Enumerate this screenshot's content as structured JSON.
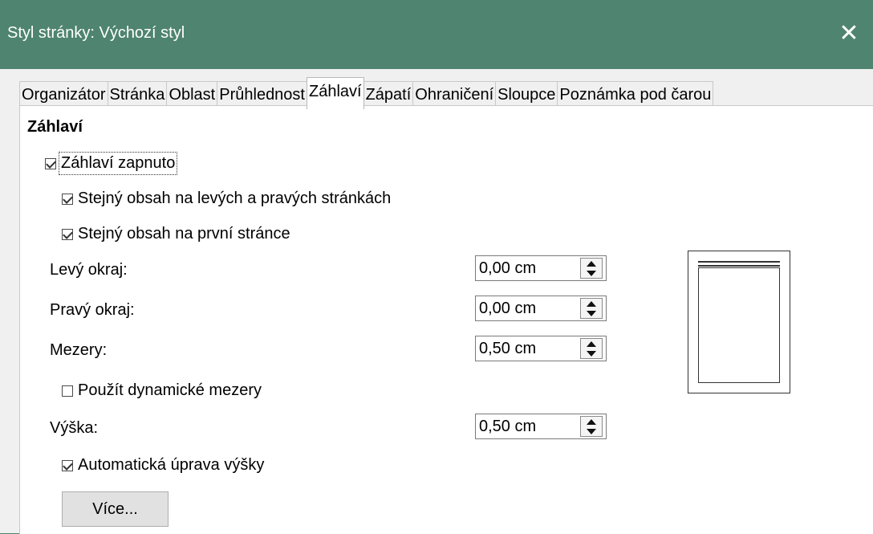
{
  "window": {
    "title": "Styl stránky: Výchozí styl",
    "close_glyph": "✕"
  },
  "tabs": [
    {
      "label": "Organizátor",
      "active": false
    },
    {
      "label": "Stránka",
      "active": false
    },
    {
      "label": "Oblast",
      "active": false
    },
    {
      "label": "Průhlednost",
      "active": false
    },
    {
      "label": "Záhlaví",
      "active": true
    },
    {
      "label": "Zápatí",
      "active": false
    },
    {
      "label": "Ohraničení",
      "active": false
    },
    {
      "label": "Sloupce",
      "active": false
    },
    {
      "label": "Poznámka pod čarou",
      "active": false
    }
  ],
  "header": {
    "section_title": "Záhlaví",
    "header_on": {
      "label": "Záhlaví zapnuto",
      "checked": true
    },
    "same_content_lr": {
      "label": "Stejný obsah na levých a pravých stránkách",
      "checked": true
    },
    "same_content_first": {
      "label": "Stejný obsah na první stránce",
      "checked": true
    },
    "left_margin": {
      "label": "Levý okraj:",
      "value": "0,00 cm"
    },
    "right_margin": {
      "label": "Pravý okraj:",
      "value": "0,00 cm"
    },
    "spacing": {
      "label": "Mezery:",
      "value": "0,50 cm"
    },
    "dynamic_spacing": {
      "label": "Použít dynamické mezery",
      "checked": false
    },
    "height": {
      "label": "Výška:",
      "value": "0,50 cm"
    },
    "autofit": {
      "label": "Automatická úprava výšky",
      "checked": true
    },
    "more_button": "Více..."
  }
}
